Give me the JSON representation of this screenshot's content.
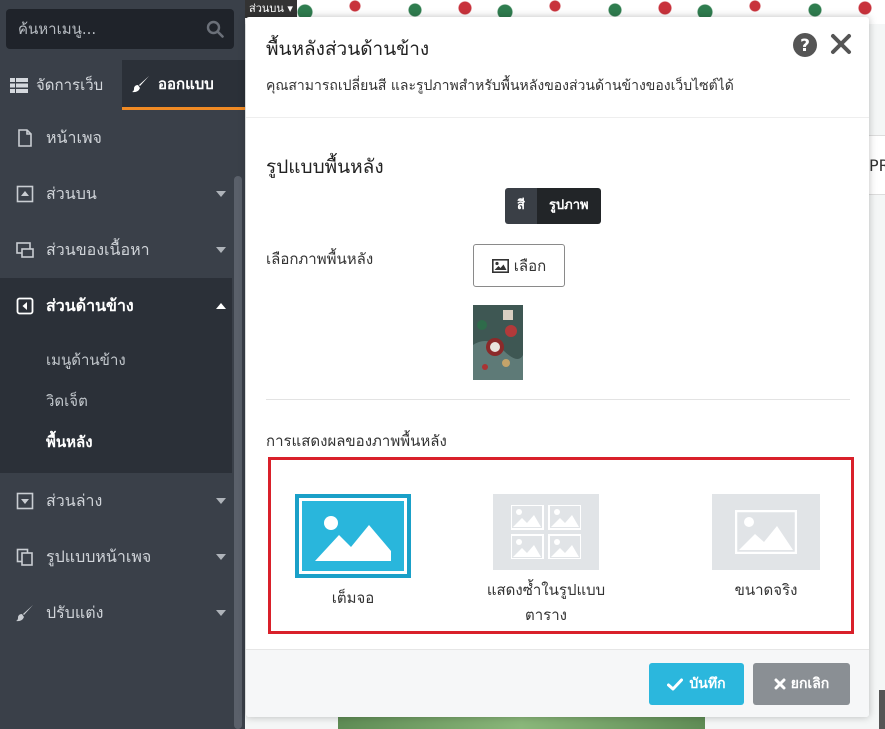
{
  "background_site": {
    "section_tag": "ส่วนบน ▾",
    "right_edge_text": "PR"
  },
  "sidebar": {
    "search": {
      "placeholder": "ค้นหาเมนู...",
      "value": "",
      "icon": "search-icon"
    },
    "tabs": [
      {
        "label": "จัดการเว็บ",
        "icon": "table-icon",
        "active": false
      },
      {
        "label": "ออกแบบ",
        "icon": "brush-icon",
        "active": true,
        "accent": "#f08a24"
      }
    ],
    "menu": [
      {
        "label": "หน้าเพจ",
        "icon": "page-icon",
        "has_caret": false
      },
      {
        "label": "ส่วนบน",
        "icon": "header-icon",
        "has_caret": true
      },
      {
        "label": "ส่วนของเนื้อหา",
        "icon": "content-icon",
        "has_caret": true
      },
      {
        "label": "ส่วนด้านข้าง",
        "icon": "sidebar-icon",
        "has_caret": true,
        "open": true
      },
      {
        "label": "ส่วนล่าง",
        "icon": "footer-icon",
        "has_caret": true
      },
      {
        "label": "รูปแบบหน้าเพจ",
        "icon": "copy-icon",
        "has_caret": true
      },
      {
        "label": "ปรับแต่ง",
        "icon": "brush-icon",
        "has_caret": true
      }
    ],
    "submenu": [
      {
        "label": "เมนูด้านข้าง",
        "active": false
      },
      {
        "label": "วิดเจ็ต",
        "active": false
      },
      {
        "label": "พื้นหลัง",
        "active": true
      }
    ]
  },
  "modal": {
    "title": "พื้นหลังส่วนด้านข้าง",
    "description": "คุณสามารถเปลี่ยนสี และรูปภาพสำหรับพื้นหลังของส่วนด้านข้างของเว็บไซต์ได้",
    "bg_style_title": "รูปแบบพื้นหลัง",
    "toggle": {
      "color_label": "สี",
      "image_label": "รูปภาพ",
      "selected": "รูปภาพ"
    },
    "choose_label": "เลือกภาพพื้นหลัง",
    "choose_button": "เลือก",
    "display_label": "การแสดงผลของภาพพื้นหลัง",
    "display_options": [
      {
        "label": "เต็มจอ",
        "selected": true,
        "icon": "fullscreen-image-icon"
      },
      {
        "label": "แสดงซ้ำในรูปแบบตาราง",
        "selected": false,
        "icon": "tile-image-icon"
      },
      {
        "label": "ขนาดจริง",
        "selected": false,
        "icon": "actual-size-image-icon"
      }
    ],
    "save_button": "บันทึก",
    "cancel_button": "ยกเลิก",
    "colors": {
      "save": "#2bb7dd",
      "cancel": "#8a8f94",
      "highlight_border": "#d9202a",
      "selected_option": "#29b6dc"
    }
  }
}
